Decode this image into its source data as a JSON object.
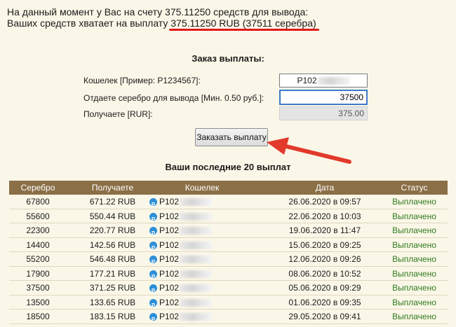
{
  "info": {
    "line1": "На данный момент у Вас на счету 375.11250 средств для вывода:",
    "line2_prefix": "Ваших средств хватает на выплату ",
    "line2_highlight": "375.11250 RUB (37511 серебра)"
  },
  "form": {
    "title": "Заказ выплаты:",
    "wallet_label": "Кошелек [Пример: P1234567]:",
    "wallet_value": "P102",
    "silver_label": "Отдаете серебро для вывода [Мин. 0.50 руб.]:",
    "silver_value": "37500",
    "receive_label": "Получаете [RUR]:",
    "receive_value": "375.00",
    "submit_label": "Заказать выплату"
  },
  "payouts": {
    "title": "Ваши последние 20 выплат",
    "headers": [
      "Серебро",
      "Получаете",
      "Кошелек",
      "Дата",
      "Статус"
    ],
    "rows": [
      {
        "silver": "67800",
        "amount": "671.22 RUB",
        "wallet": "P102",
        "date": "26.06.2020 в 09:57",
        "status": "Выплачено"
      },
      {
        "silver": "55600",
        "amount": "550.44 RUB",
        "wallet": "P102",
        "date": "22.06.2020 в 10:03",
        "status": "Выплачено"
      },
      {
        "silver": "22300",
        "amount": "220.77 RUB",
        "wallet": "P102",
        "date": "19.06.2020 в 11:47",
        "status": "Выплачено"
      },
      {
        "silver": "14400",
        "amount": "142.56 RUB",
        "wallet": "P102",
        "date": "15.06.2020 в 09:25",
        "status": "Выплачено"
      },
      {
        "silver": "55200",
        "amount": "546.48 RUB",
        "wallet": "P102",
        "date": "12.06.2020 в 09:26",
        "status": "Выплачено"
      },
      {
        "silver": "17900",
        "amount": "177.21 RUB",
        "wallet": "P102",
        "date": "08.06.2020 в 10:52",
        "status": "Выплачено"
      },
      {
        "silver": "37500",
        "amount": "371.25 RUB",
        "wallet": "P102",
        "date": "05.06.2020 в 09:29",
        "status": "Выплачено"
      },
      {
        "silver": "13500",
        "amount": "133.65 RUB",
        "wallet": "P102",
        "date": "01.06.2020 в 09:35",
        "status": "Выплачено"
      },
      {
        "silver": "18500",
        "amount": "183.15 RUB",
        "wallet": "P102",
        "date": "29.05.2020 в 09:41",
        "status": "Выплачено"
      }
    ]
  },
  "icons": {
    "payeer": "P"
  },
  "colors": {
    "header_bg": "#8b6f47",
    "status": "#2d7a1e",
    "accent_red": "#e0191a"
  }
}
